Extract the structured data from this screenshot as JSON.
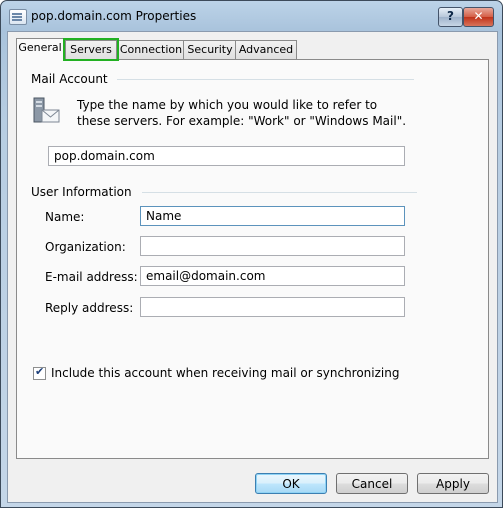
{
  "window": {
    "title": "pop.domain.com Properties",
    "help_label": "?",
    "close_label": "✕"
  },
  "tabs": [
    {
      "label": "General"
    },
    {
      "label": "Servers"
    },
    {
      "label": "Connection"
    },
    {
      "label": "Security"
    },
    {
      "label": "Advanced"
    }
  ],
  "mail_account": {
    "heading": "Mail Account",
    "description": "Type the name by which you would like to refer to these servers.  For example: \"Work\" or \"Windows Mail\".",
    "value": "pop.domain.com"
  },
  "user_info": {
    "heading": "User Information",
    "fields": [
      {
        "label": "Name:",
        "value": "Name"
      },
      {
        "label": "Organization:",
        "value": ""
      },
      {
        "label": "E-mail address:",
        "value": "email@domain.com"
      },
      {
        "label": "Reply address:",
        "value": ""
      }
    ]
  },
  "include_checkbox": {
    "label": "Include this account when receiving mail or synchronizing",
    "checked": true
  },
  "buttons": {
    "ok": "OK",
    "cancel": "Cancel",
    "apply": "Apply"
  },
  "colors": {
    "highlight": "#22b022",
    "title_gradient_top": "#bcd3e8"
  }
}
